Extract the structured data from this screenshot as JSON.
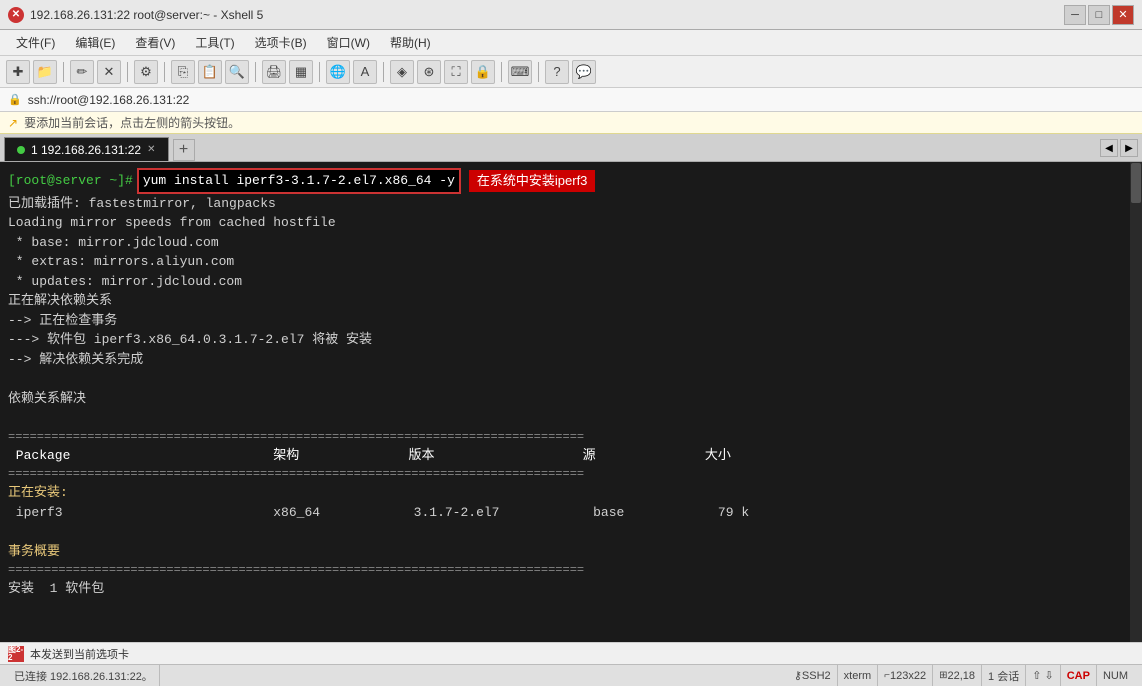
{
  "titlebar": {
    "ip": "192.168.26.131:22",
    "user": "root@server:~",
    "app": "Xshell 5",
    "title": "192.168.26.131:22    root@server:~ - Xshell 5"
  },
  "menubar": {
    "items": [
      "文件(F)",
      "编辑(E)",
      "查看(V)",
      "工具(T)",
      "选项卡(B)",
      "窗口(W)",
      "帮助(H)"
    ]
  },
  "addressbar": {
    "url": "ssh://root@192.168.26.131:22"
  },
  "banner": {
    "text": "要添加当前会话，点击左侧的箭头按钮。"
  },
  "tabs": {
    "active": "1 192.168.26.131:22",
    "add_label": "+"
  },
  "terminal": {
    "prompt": "[root@server ~]#",
    "command": "yum install iperf3-3.1.7-2.el7.x86_64 -y",
    "annotation": "在系统中安装iperf3",
    "lines": [
      "已加载插件: fastestmirror, langpacks",
      "Loading mirror speeds from cached hostfile",
      " * base: mirror.jdcloud.com",
      " * extras: mirrors.aliyun.com",
      " * updates: mirror.jdcloud.com",
      "正在解决依赖关系",
      "--> 正在检查事务",
      "--> 软件包 iperf3.x86_64.0.3.1.7-2.el7 将被 安装",
      "--> 解决依赖关系完成",
      "",
      "依赖关系解决",
      "",
      "================================================================================",
      "table_header",
      "================================================================================",
      "正在安装:",
      "installing_row",
      "",
      "事务概要",
      "================================================================================",
      "安装  1 软件包"
    ],
    "table": {
      "header": " Package                  架构             版本                 源            大小",
      "row_package": " iperf3",
      "row_arch": "x86_64",
      "row_version": "3.1.7-2.el7",
      "row_repo": "base",
      "row_size": "79 k"
    }
  },
  "bottom_notification": {
    "label": "图2-2",
    "text": "本发送到当前选项卡"
  },
  "statusbar": {
    "connection": "已连接 192.168.26.131:22。",
    "protocol": "SSH2",
    "terminal": "xterm",
    "rows_cols": "123x22",
    "position": "22,18",
    "sessions": "1 会话",
    "cap": "CAP",
    "num": "NUM"
  }
}
